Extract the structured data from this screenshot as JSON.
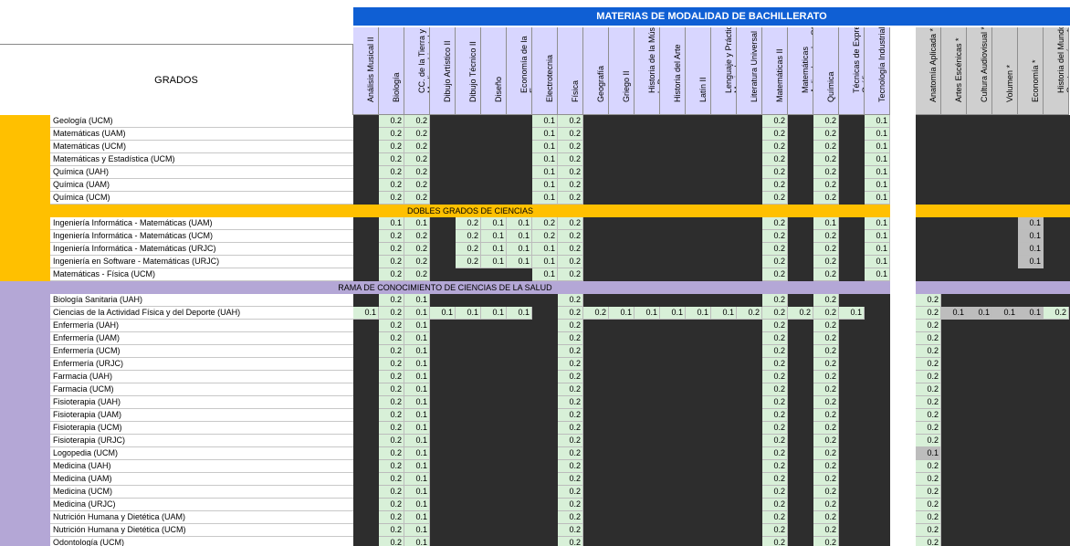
{
  "title": "MATERIAS DE MODALIDAD DE BACHILLERATO",
  "grados_label": "GRADOS",
  "subjects_main": [
    "Análisis Musical II",
    "Biología",
    "CC. de la Tierra y Medioambientales",
    "Dibujo Artístico II",
    "Dibujo Técnico II",
    "Diseño",
    "Economía de la Empresa",
    "Electrotecnia",
    "Física",
    "Geografía",
    "Griego II",
    "Historia de la Música y la Danza",
    "Historia del Arte",
    "Latín II",
    "Lenguaje y Práctica Musical",
    "Literatura Universal",
    "Matemáticas II",
    "Matemáticas Aplicadas a las CC.",
    "Química",
    "Técnicas de Expresión Gráfico-",
    "Tecnología Industrial II"
  ],
  "subjects_extra": [
    "Anatomía Aplicada *",
    "Artes Escénicas *",
    "Cultura Audiovisual *",
    "Volumen *",
    "Economía *",
    "Historia del Mundo Contemporáneo *"
  ],
  "bands": {
    "dobles": "DOBLES GRADOS DE CIENCIAS",
    "salud": "RAMA DE CONOCIMIENTO DE CIENCIAS DE LA SALUD"
  },
  "group1": [
    {
      "name": "Geología (UCM)",
      "v": {
        "1": "0.2",
        "2": "0.2",
        "7": "0.1",
        "8": "0.2",
        "16": "0.2",
        "18": "0.2",
        "20": "0.1"
      }
    },
    {
      "name": "Matemáticas (UAM)",
      "v": {
        "1": "0.2",
        "2": "0.2",
        "7": "0.1",
        "8": "0.2",
        "16": "0.2",
        "18": "0.2",
        "20": "0.1"
      }
    },
    {
      "name": "Matemáticas (UCM)",
      "v": {
        "1": "0.2",
        "2": "0.2",
        "7": "0.1",
        "8": "0.2",
        "16": "0.2",
        "18": "0.2",
        "20": "0.1"
      }
    },
    {
      "name": "Matemáticas y Estadística (UCM)",
      "v": {
        "1": "0.2",
        "2": "0.2",
        "7": "0.1",
        "8": "0.2",
        "16": "0.2",
        "18": "0.2",
        "20": "0.1"
      }
    },
    {
      "name": "Química (UAH)",
      "v": {
        "1": "0.2",
        "2": "0.2",
        "7": "0.1",
        "8": "0.2",
        "16": "0.2",
        "18": "0.2",
        "20": "0.1"
      }
    },
    {
      "name": "Química (UAM)",
      "v": {
        "1": "0.2",
        "2": "0.2",
        "7": "0.1",
        "8": "0.2",
        "16": "0.2",
        "18": "0.2",
        "20": "0.1"
      }
    },
    {
      "name": "Química (UCM)",
      "v": {
        "1": "0.2",
        "2": "0.2",
        "7": "0.1",
        "8": "0.2",
        "16": "0.2",
        "18": "0.2",
        "20": "0.1"
      }
    }
  ],
  "group2": [
    {
      "name": "Ingeniería Informática - Matemáticas (UAM)",
      "v": {
        "1": "0.1",
        "2": "0.1",
        "4": "0.2",
        "5": "0.1",
        "6": "0.1",
        "7": "0.2",
        "8": "0.2",
        "16": "0.2",
        "18": "0.1",
        "20": "0.1"
      },
      "x": {
        "4": "0.1"
      }
    },
    {
      "name": "Ingeniería Informática - Matemáticas (UCM)",
      "v": {
        "1": "0.2",
        "2": "0.2",
        "4": "0.2",
        "5": "0.1",
        "6": "0.1",
        "7": "0.2",
        "8": "0.2",
        "16": "0.2",
        "18": "0.2",
        "20": "0.1"
      },
      "x": {
        "4": "0.1"
      }
    },
    {
      "name": "Ingeniería Informática - Matemáticas (URJC)",
      "v": {
        "1": "0.2",
        "2": "0.2",
        "4": "0.2",
        "5": "0.1",
        "6": "0.1",
        "7": "0.1",
        "8": "0.2",
        "16": "0.2",
        "18": "0.2",
        "20": "0.1"
      },
      "x": {
        "4": "0.1"
      }
    },
    {
      "name": "Ingeniería en Software - Matemáticas (URJC)",
      "v": {
        "1": "0.2",
        "2": "0.2",
        "4": "0.2",
        "5": "0.1",
        "6": "0.1",
        "7": "0.1",
        "8": "0.2",
        "16": "0.2",
        "18": "0.2",
        "20": "0.1"
      },
      "x": {
        "4": "0.1"
      }
    },
    {
      "name": "Matemáticas - Física (UCM)",
      "v": {
        "1": "0.2",
        "2": "0.2",
        "7": "0.1",
        "8": "0.2",
        "16": "0.2",
        "18": "0.2",
        "20": "0.1"
      }
    }
  ],
  "group3": [
    {
      "name": "Biología Sanitaria (UAH)",
      "v": {
        "1": "0.2",
        "2": "0.1",
        "8": "0.2",
        "16": "0.2",
        "18": "0.2"
      },
      "x": {
        "0": "0.2"
      }
    },
    {
      "name": "Ciencias de la Actividad Física y del Deporte (UAH)",
      "v": {
        "0": "0.1",
        "1": "0.2",
        "2": "0.1",
        "3": "0.1",
        "4": "0.1",
        "5": "0.1",
        "6": "0.1",
        "8": "0.2",
        "9": "0.2",
        "10": "0.1",
        "11": "0.1",
        "12": "0.1",
        "13": "0.1",
        "14": "0.1",
        "15": "0.2",
        "16": "0.2",
        "17": "0.2",
        "18": "0.2",
        "19": "0.1"
      },
      "x": {
        "0": "0.2",
        "1": "0.1",
        "2": "0.1",
        "3": "0.1",
        "4": "0.1",
        "5": "0.2"
      }
    },
    {
      "name": "Enfermería (UAH)",
      "v": {
        "1": "0.2",
        "2": "0.1",
        "8": "0.2",
        "16": "0.2",
        "18": "0.2"
      },
      "x": {
        "0": "0.2"
      }
    },
    {
      "name": "Enfermería (UAM)",
      "v": {
        "1": "0.2",
        "2": "0.1",
        "8": "0.2",
        "16": "0.2",
        "18": "0.2"
      },
      "x": {
        "0": "0.2"
      }
    },
    {
      "name": "Enfermería (UCM)",
      "v": {
        "1": "0.2",
        "2": "0.1",
        "8": "0.2",
        "16": "0.2",
        "18": "0.2"
      },
      "x": {
        "0": "0.2"
      }
    },
    {
      "name": "Enfermería (URJC)",
      "v": {
        "1": "0.2",
        "2": "0.1",
        "8": "0.2",
        "16": "0.2",
        "18": "0.2"
      },
      "x": {
        "0": "0.2"
      }
    },
    {
      "name": "Farmacia (UAH)",
      "v": {
        "1": "0.2",
        "2": "0.1",
        "8": "0.2",
        "16": "0.2",
        "18": "0.2"
      },
      "x": {
        "0": "0.2"
      }
    },
    {
      "name": "Farmacia (UCM)",
      "v": {
        "1": "0.2",
        "2": "0.1",
        "8": "0.2",
        "16": "0.2",
        "18": "0.2"
      },
      "x": {
        "0": "0.2"
      }
    },
    {
      "name": "Fisioterapia (UAH)",
      "v": {
        "1": "0.2",
        "2": "0.1",
        "8": "0.2",
        "16": "0.2",
        "18": "0.2"
      },
      "x": {
        "0": "0.2"
      }
    },
    {
      "name": "Fisioterapia (UAM)",
      "v": {
        "1": "0.2",
        "2": "0.1",
        "8": "0.2",
        "16": "0.2",
        "18": "0.2"
      },
      "x": {
        "0": "0.2"
      }
    },
    {
      "name": "Fisioterapia (UCM)",
      "v": {
        "1": "0.2",
        "2": "0.1",
        "8": "0.2",
        "16": "0.2",
        "18": "0.2"
      },
      "x": {
        "0": "0.2"
      }
    },
    {
      "name": "Fisioterapia (URJC)",
      "v": {
        "1": "0.2",
        "2": "0.1",
        "8": "0.2",
        "16": "0.2",
        "18": "0.2"
      },
      "x": {
        "0": "0.2"
      }
    },
    {
      "name": "Logopedia (UCM)",
      "v": {
        "1": "0.2",
        "2": "0.1",
        "8": "0.2",
        "16": "0.2",
        "18": "0.2"
      },
      "x": {
        "0": "0.1"
      }
    },
    {
      "name": "Medicina (UAH)",
      "v": {
        "1": "0.2",
        "2": "0.1",
        "8": "0.2",
        "16": "0.2",
        "18": "0.2"
      },
      "x": {
        "0": "0.2"
      }
    },
    {
      "name": "Medicina (UAM)",
      "v": {
        "1": "0.2",
        "2": "0.1",
        "8": "0.2",
        "16": "0.2",
        "18": "0.2"
      },
      "x": {
        "0": "0.2"
      }
    },
    {
      "name": "Medicina (UCM)",
      "v": {
        "1": "0.2",
        "2": "0.1",
        "8": "0.2",
        "16": "0.2",
        "18": "0.2"
      },
      "x": {
        "0": "0.2"
      }
    },
    {
      "name": "Medicina (URJC)",
      "v": {
        "1": "0.2",
        "2": "0.1",
        "8": "0.2",
        "16": "0.2",
        "18": "0.2"
      },
      "x": {
        "0": "0.2"
      }
    },
    {
      "name": "Nutrición Humana y Dietética (UAM)",
      "v": {
        "1": "0.2",
        "2": "0.1",
        "8": "0.2",
        "16": "0.2",
        "18": "0.2"
      },
      "x": {
        "0": "0.2"
      }
    },
    {
      "name": "Nutrición Humana y Dietética (UCM)",
      "v": {
        "1": "0.2",
        "2": "0.1",
        "8": "0.2",
        "16": "0.2",
        "18": "0.2"
      },
      "x": {
        "0": "0.2"
      }
    },
    {
      "name": "Odontología (UCM)",
      "v": {
        "1": "0.2",
        "2": "0.1",
        "8": "0.2",
        "16": "0.2",
        "18": "0.2"
      },
      "x": {
        "0": "0.2"
      }
    }
  ],
  "colors": {
    "header_blue": "#0f5fd4",
    "subject_header": "#d8d6ff",
    "orange": "#ffc000",
    "lavender": "#b4a7d6",
    "value_green": "#d8f0d8",
    "dark": "#2d2d2d"
  }
}
